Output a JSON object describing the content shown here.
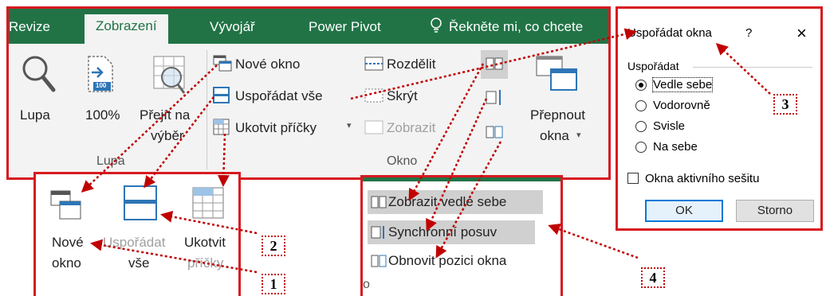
{
  "ribbon": {
    "tabs": [
      "Revize",
      "Zobrazení",
      "Vývojář",
      "Power Pivot",
      "Řekněte mi, co chcete"
    ],
    "zoom_group": {
      "lupa": "Lupa",
      "hundred": "100%",
      "hundred_icon": "100",
      "jump_line1": "Přejít na",
      "jump_line2": "výběr",
      "group_label": "Lupa"
    },
    "window_group": {
      "new_window": "Nové okno",
      "arrange_all": "Uspořádat vše",
      "freeze_panes": "Ukotvit příčky",
      "split": "Rozdělit",
      "hide": "Skrýt",
      "unhide": "Zobrazit",
      "switch_line1": "Přepnout",
      "switch_line2": "okna",
      "group_label": "Okno"
    }
  },
  "panel_left": {
    "new_line1": "Nové",
    "new_line2": "okno",
    "arrange_line1": "Uspořádat",
    "arrange_line2": "vše",
    "freeze_line1": "Ukotvit",
    "freeze_line2": "příčky"
  },
  "panel_middle": {
    "side_by_side": "Zobrazit vedle sebe",
    "sync_scroll": "Synchronní posuv",
    "reset_position": "Obnovit pozici okna",
    "group_fragment": "o"
  },
  "dialog": {
    "title": "Uspořádat okna",
    "help": "?",
    "close": "×",
    "section": "Uspořádat",
    "options": [
      "Vedle sebe",
      "Vodorovně",
      "Svisle",
      "Na sebe"
    ],
    "selected": "Vedle sebe",
    "checkbox": "Okna aktivního sešitu",
    "ok": "OK",
    "cancel": "Storno"
  },
  "markers": [
    "1",
    "2",
    "3",
    "4"
  ],
  "colors": {
    "accent": "#217346",
    "annotation": "#d71920"
  }
}
